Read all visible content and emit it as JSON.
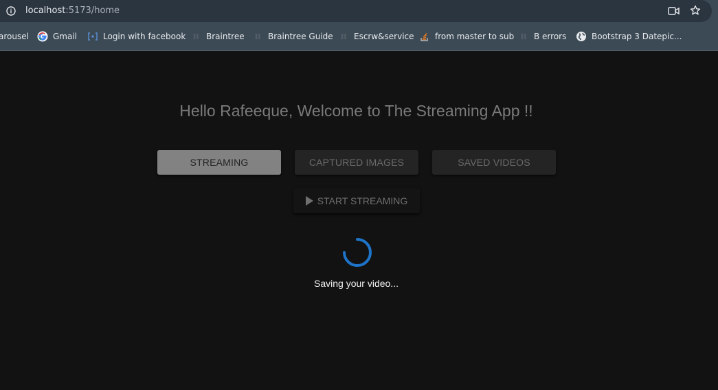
{
  "browser": {
    "url_host": "localhost",
    "url_path": ":5173/home",
    "bookmarks": [
      {
        "label": "arousel",
        "icon": "none"
      },
      {
        "label": "Gmail",
        "icon": "google-icon"
      },
      {
        "label": "Login with facebook",
        "icon": "bracket-icon"
      },
      {
        "label": "Braintree",
        "icon": "b-icon"
      },
      {
        "label": "Braintree Guide",
        "icon": "b-icon"
      },
      {
        "label": "Escrw&service",
        "icon": "b-icon"
      },
      {
        "label": "from master to sub",
        "icon": "stackoverflow-icon"
      },
      {
        "label": "B errors",
        "icon": "b-icon"
      },
      {
        "label": "Bootstrap 3 Datepic...",
        "icon": "globe-icon"
      }
    ]
  },
  "app": {
    "welcome": "Hello Rafeeque, Welcome to The Streaming App !!",
    "tabs": {
      "streaming": "STREAMING",
      "captured": "CAPTURED IMAGES",
      "saved": "SAVED VIDEOS"
    },
    "start_label": "START STREAMING",
    "status": "Saving your video...",
    "accent_color": "#1e74c8"
  }
}
